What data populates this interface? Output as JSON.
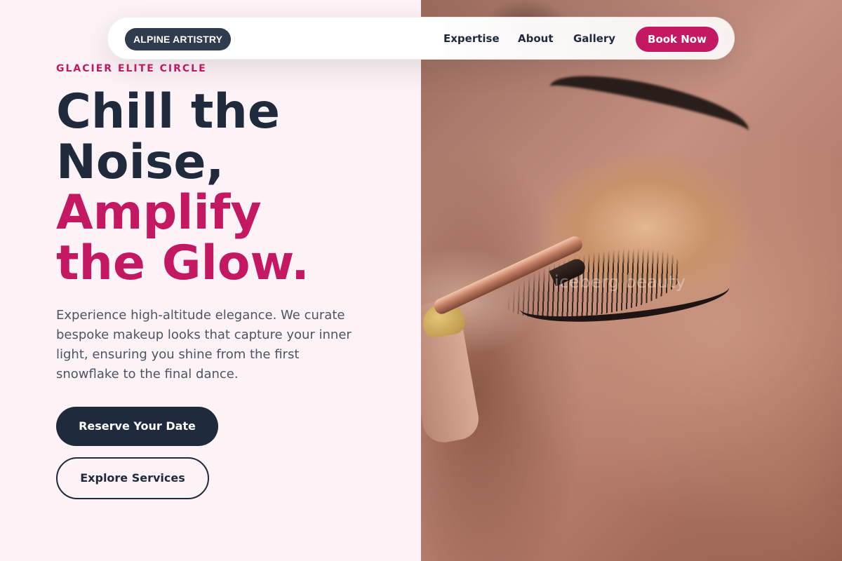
{
  "nav": {
    "logo": "ALPINE ARTISTRY",
    "links": [
      "Expertise",
      "About",
      "Gallery"
    ],
    "cta": "Book Now"
  },
  "hero": {
    "eyebrow": "GLACIER ELITE CIRCLE",
    "headline_dark": [
      "Chill the",
      "Noise,"
    ],
    "headline_accent": [
      "Amplify",
      "the Glow."
    ],
    "body": "Experience high-altitude elegance. We curate bespoke makeup looks that capture your inner light, ensuring you shine from the first snowflake to the final dance.",
    "primary_cta": "Reserve Your Date",
    "secondary_cta": "Explore Services"
  },
  "image": {
    "watermark": "iceberg beauty"
  },
  "colors": {
    "accent": "#c41862",
    "navy": "#1f2a3d",
    "background": "#fdf2f6"
  }
}
